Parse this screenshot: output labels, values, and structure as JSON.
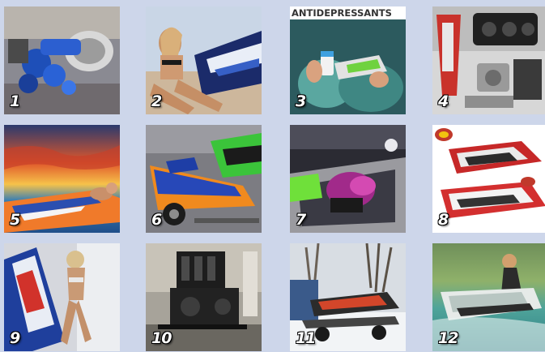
{
  "gallery": {
    "tiles": [
      {
        "number": "1",
        "subject": "blue-engine-parts"
      },
      {
        "number": "2",
        "subject": "woman-on-jetski-beach"
      },
      {
        "number": "3",
        "subject": "antidepressants-meme",
        "caption": "ANTIDEPRESSANTS"
      },
      {
        "number": "4",
        "subject": "engine-parts-kit"
      },
      {
        "number": "5",
        "subject": "sunset-jetski"
      },
      {
        "number": "6",
        "subject": "orange-blue-jetskis-trailer"
      },
      {
        "number": "7",
        "subject": "purple-green-engine-bay"
      },
      {
        "number": "8",
        "subject": "red-white-jetskis-logo"
      },
      {
        "number": "9",
        "subject": "woman-with-jetski"
      },
      {
        "number": "10",
        "subject": "black-engine-stand"
      },
      {
        "number": "11",
        "subject": "jetski-on-cart-snow"
      },
      {
        "number": "12",
        "subject": "rider-on-water"
      }
    ]
  },
  "colors": {
    "background": "#cdd6ea",
    "number_text": "#ffffff"
  }
}
